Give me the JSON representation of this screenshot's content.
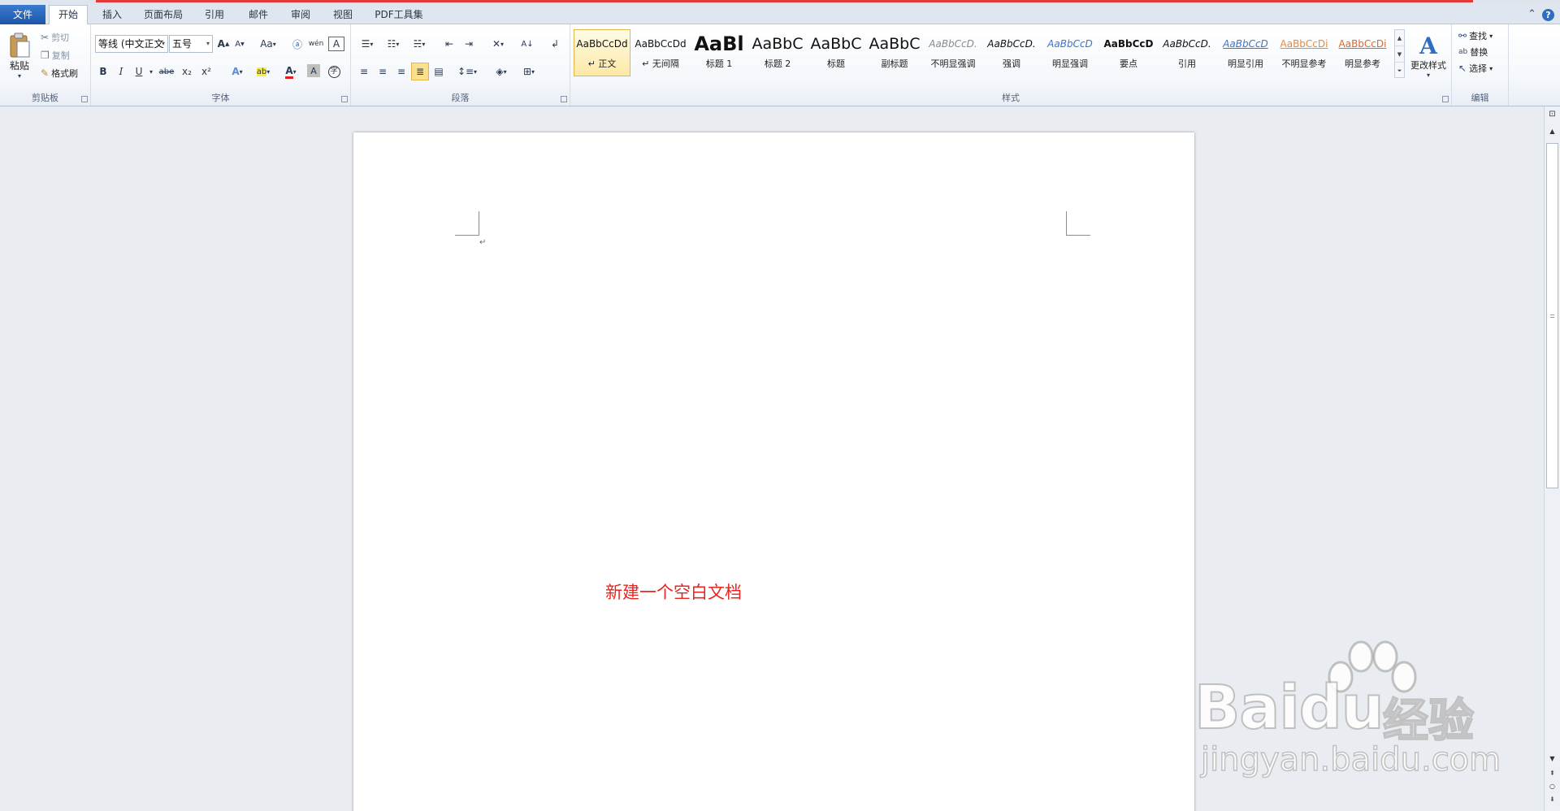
{
  "tabs": {
    "file": "文件",
    "home": "开始",
    "insert": "插入",
    "layout": "页面布局",
    "references": "引用",
    "mailings": "邮件",
    "review": "审阅",
    "view": "视图",
    "pdf": "PDF工具集"
  },
  "clipboard": {
    "paste": "粘贴",
    "cut": "剪切",
    "copy": "复制",
    "format_painter": "格式刷",
    "label": "剪贴板"
  },
  "font": {
    "family": "等线 (中文正文",
    "size": "五号",
    "label": "字体",
    "case_label": "Aa",
    "bold": "B",
    "italic": "I",
    "underline": "U",
    "strike": "abe",
    "subscript": "x₂",
    "superscript": "x²",
    "grow": "A",
    "shrink": "A",
    "char_border": "A",
    "highlight": "ab",
    "font_color": "A",
    "char_shade": "A",
    "enclose": "字"
  },
  "paragraph": {
    "label": "段落"
  },
  "styles": {
    "label": "样式",
    "items": [
      {
        "preview": "AaBbCcDd",
        "name": "↵ 正文",
        "selected": true
      },
      {
        "preview": "AaBbCcDd",
        "name": "↵ 无间隔"
      },
      {
        "preview": "AaBl",
        "name": "标题 1"
      },
      {
        "preview": "AaBbC",
        "name": "标题 2"
      },
      {
        "preview": "AaBbC",
        "name": "标题"
      },
      {
        "preview": "AaBbC",
        "name": "副标题"
      },
      {
        "preview": "AaBbCcD.",
        "name": "不明显强调"
      },
      {
        "preview": "AaBbCcD.",
        "name": "强调"
      },
      {
        "preview": "AaBbCcD",
        "name": "明显强调"
      },
      {
        "preview": "AaBbCcD",
        "name": "要点"
      },
      {
        "preview": "AaBbCcD.",
        "name": "引用"
      },
      {
        "preview": "AaBbCcD",
        "name": "明显引用"
      },
      {
        "preview": "AaBbCcDi",
        "name": "不明显参考"
      },
      {
        "preview": "AaBbCcDi",
        "name": "明显参考"
      }
    ],
    "change": "更改样式"
  },
  "editing": {
    "label": "编辑",
    "find": "查找",
    "replace": "替换",
    "select": "选择"
  },
  "document": {
    "annotation": "新建一个空白文档",
    "paragraph_mark": "↵"
  },
  "watermark": {
    "logo": "Bai",
    "logo2": "du",
    "cn": "经验",
    "url": "jingyan.baidu.com"
  },
  "colors": {
    "annotation": "#e8251f",
    "file_tab": "#1c55a8",
    "selected_style": "#fde9a6"
  }
}
